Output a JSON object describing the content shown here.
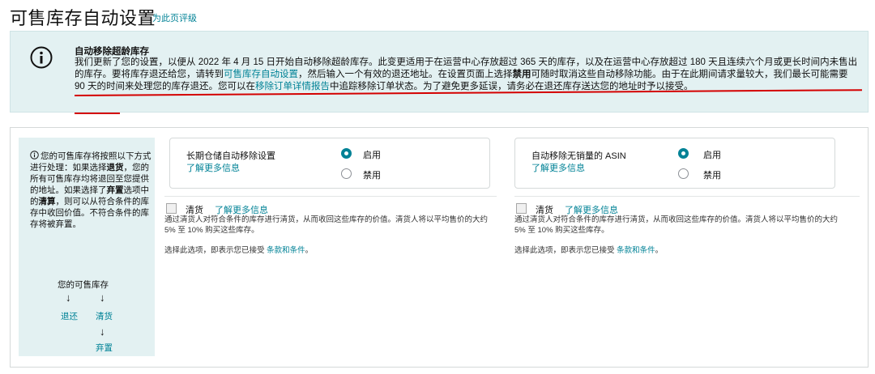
{
  "header": {
    "title": "可售库存自动设置",
    "rate_link": "为此页评级"
  },
  "alert": {
    "icon": "info-icon",
    "title": "自动移除超龄库存",
    "body_1": "我们更新了您的设置，以便从 2022 年 4 月 15 日开始自动移除超龄库存。此变更适用于在运营中心存放超过 365 天的库存，以及在运营中心存放超过 180 天且连续六个月或更长时间内未售出的库存。要将库存退还给您，请转到",
    "body_link_1": "可售库存自动设置",
    "body_2": "，然后输入一个有效的退还地址。在设置页面上选择",
    "body_bold": "禁用",
    "body_3": "可随时取消这些自动移除功能。由于在此期间请求量较大，我们最长可能需要 90 天的时间来处理您的库存退还。您可以在",
    "body_link_2": "移除订单详情报告",
    "body_4": "中追踪移除订单状态。为了避免更多延误，请务必在退还库存送达您的地址时予以接受。",
    "annotation_color": "#d40000"
  },
  "sidebar": {
    "icon": "info-icon",
    "text_1": "您的可售库存将按照以下方式进行处理：如果选择",
    "bold_1": "退货",
    "text_2": "，您的所有可售库存均将退回至您提供的地址。如果选择了",
    "bold_2": "弃置",
    "text_3": "选项中的",
    "bold_3": "清算",
    "text_4": "，则可以从符合条件的库存中收回价值。不符合条件的库存将被弃置。",
    "flow": {
      "title": "您的可售库存",
      "arrow": "↓",
      "return": "退还",
      "clear": "清货",
      "dispose": "弃置"
    }
  },
  "settings": [
    {
      "label": "长期仓储自动移除设置",
      "learn_more": "了解更多信息",
      "options": [
        "启用",
        "禁用"
      ],
      "selected": "启用"
    },
    {
      "label": "自动移除无销量的 ASIN",
      "learn_more": "了解更多信息",
      "options": [
        "启用",
        "禁用"
      ],
      "selected": "启用"
    }
  ],
  "liquidation": [
    {
      "label": "清货",
      "learn_more": "了解更多信息",
      "checked": false,
      "description": "通过清货人对符合条件的库存进行清货，从而收回这些库存的价值。清货人将以平均售价的大约 5% 至 10% 购买这些库存。",
      "terms_prefix": "选择此选项，即表示您已接受",
      "terms_link": "条款和条件",
      "terms_suffix": "。"
    },
    {
      "label": "清货",
      "learn_more": "了解更多信息",
      "checked": false,
      "description": "通过清货人对符合条件的库存进行清货，从而收回这些库存的价值。清货人将以平均售价的大约 5% 至 10% 购买这些库存。",
      "terms_prefix": "选择此选项，即表示您已接受",
      "terms_link": "条款和条件",
      "terms_suffix": "。"
    }
  ],
  "colors": {
    "accent": "#008296",
    "alert_bg": "#e3f1f2",
    "border": "#d5d9d9"
  }
}
